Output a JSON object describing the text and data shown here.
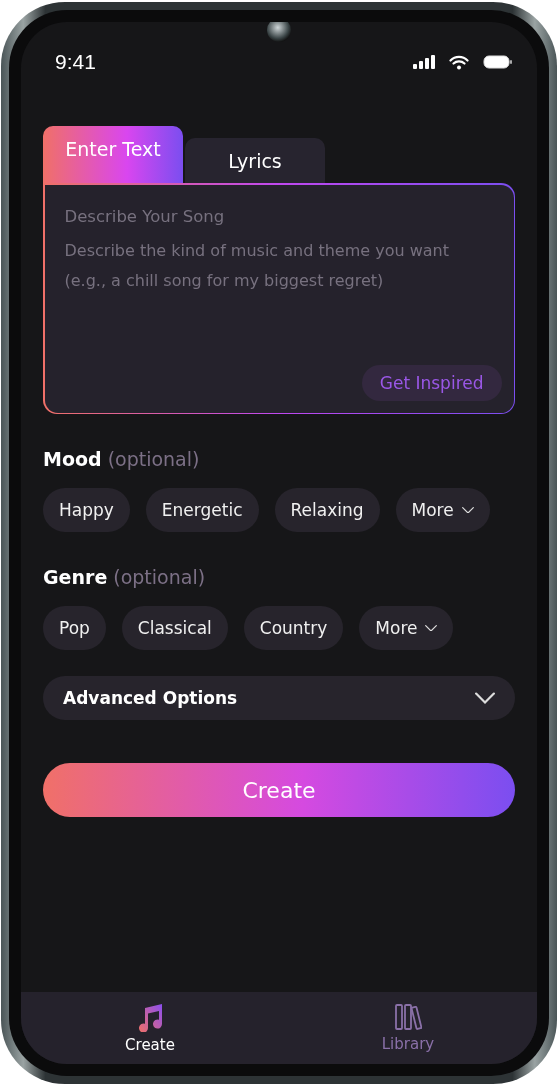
{
  "status_bar": {
    "time": "9:41"
  },
  "tabs": [
    {
      "label": "Enter Text",
      "selected": true
    },
    {
      "label": "Lyrics",
      "selected": false
    }
  ],
  "prompt": {
    "label": "Describe Your Song",
    "placeholder": "Describe the kind of music and theme you want (e.g., a chill song for my biggest regret)",
    "button": "Get Inspired"
  },
  "mood": {
    "label": "Mood",
    "hint": "(optional)",
    "options": [
      {
        "label": "Happy",
        "kind": "option"
      },
      {
        "label": "Energetic",
        "kind": "option"
      },
      {
        "label": "Relaxing",
        "kind": "option"
      },
      {
        "label": "More",
        "kind": "more"
      }
    ]
  },
  "genre": {
    "label": "Genre",
    "hint": "(optional)",
    "options": [
      {
        "label": "Pop",
        "kind": "option"
      },
      {
        "label": "Classical",
        "kind": "option"
      },
      {
        "label": "Country",
        "kind": "option"
      },
      {
        "label": "More",
        "kind": "more"
      }
    ]
  },
  "advanced": {
    "label": "Advanced Options",
    "expanded": false
  },
  "create_button": "Create",
  "nav": [
    {
      "label": "Create",
      "kind": "create",
      "selected": true
    },
    {
      "label": "Library",
      "kind": "library",
      "selected": false
    }
  ]
}
